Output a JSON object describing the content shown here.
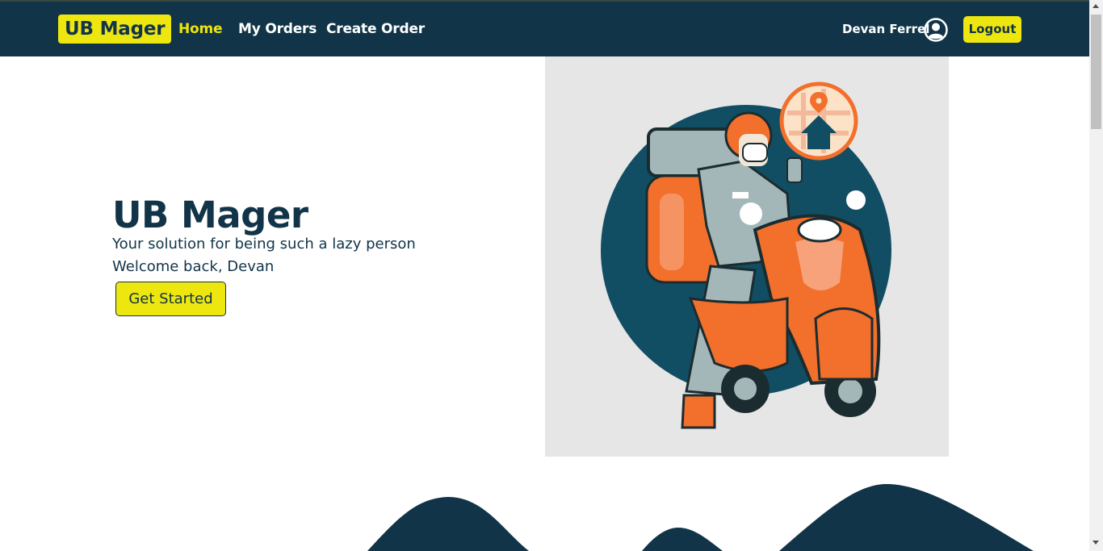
{
  "navbar": {
    "brand": "UB Mager",
    "links": [
      "Home",
      "My Orders",
      "Create Order"
    ],
    "active_link": "Home",
    "user_name": "Devan Ferrel",
    "logout_label": "Logout"
  },
  "hero": {
    "title": "UB Mager",
    "subtitle": "Your solution for being such a lazy person",
    "welcome": "Welcome back, Devan",
    "cta_label": "Get Started"
  },
  "illustration": {
    "subject": "delivery rider on orange scooter with location pin badge",
    "icons": [
      "user-circle-icon",
      "location-pin-icon",
      "home-icon"
    ]
  },
  "colors": {
    "navy": "#113448",
    "yellow": "#ede60f",
    "orange": "#f26f2c",
    "teal_circle": "#124e63",
    "illustration_bg": "#e6e6e6"
  }
}
